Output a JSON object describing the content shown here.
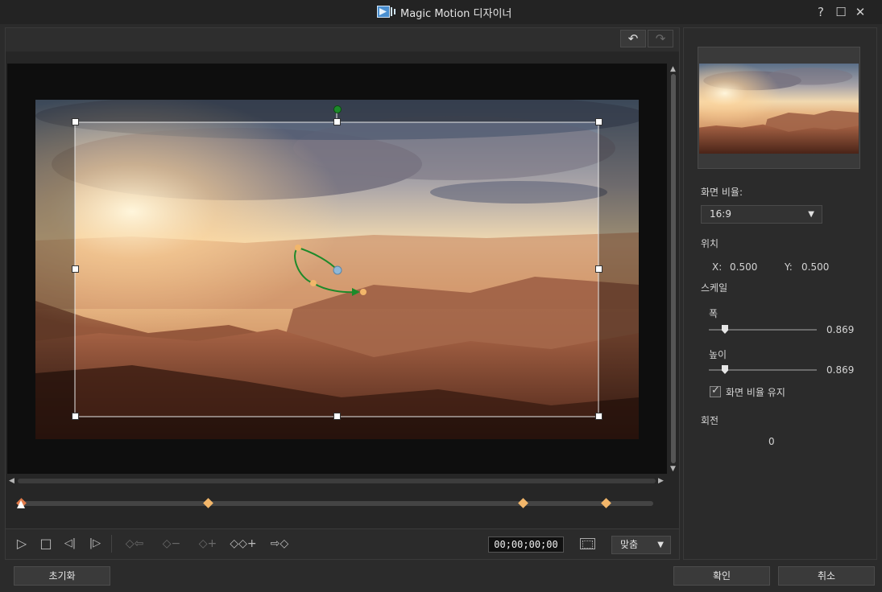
{
  "window": {
    "title": "Magic Motion 디자이너",
    "help_label": "?",
    "maximize_label": "☐",
    "close_label": "✕"
  },
  "toolbar": {
    "undo_label": "↶",
    "redo_label": "↷"
  },
  "timeline": {
    "keyframes_fraction": [
      0,
      0.298,
      0.798,
      0.93
    ],
    "playhead_fraction": 0
  },
  "controls": {
    "play_label": "▷",
    "stop_label": "□",
    "prev_frame_label": "◁|",
    "next_frame_label": "|▷",
    "prev_keyframe_label": "◇⇦",
    "remove_keyframe_label": "◇−",
    "add_keyframe_label": "◇+",
    "duplicate_keyframe_label": "◇◇+",
    "next_keyframe_label": "⇨◇",
    "timecode": "00;00;00;00",
    "fit_value": "맞춤"
  },
  "properties": {
    "aspect_label": "화면 비율:",
    "aspect_value": "16:9",
    "position_label": "위치",
    "x_label": "X:",
    "x_value": "0.500",
    "y_label": "Y:",
    "y_value": "0.500",
    "scale_label": "스케일",
    "width_label": "폭",
    "width_value": "0.869",
    "height_label": "높이",
    "height_value": "0.869",
    "keep_aspect_label": "화면 비율 유지",
    "keep_aspect_checked": true,
    "rotation_label": "회전",
    "rotation_value": "0"
  },
  "buttons": {
    "reset_label": "초기화",
    "ok_label": "확인",
    "cancel_label": "취소"
  },
  "colors": {
    "keyframe": "#f2b66a",
    "motion_path": "#1d8a2a",
    "handle_blue": "#8fb8d8"
  }
}
